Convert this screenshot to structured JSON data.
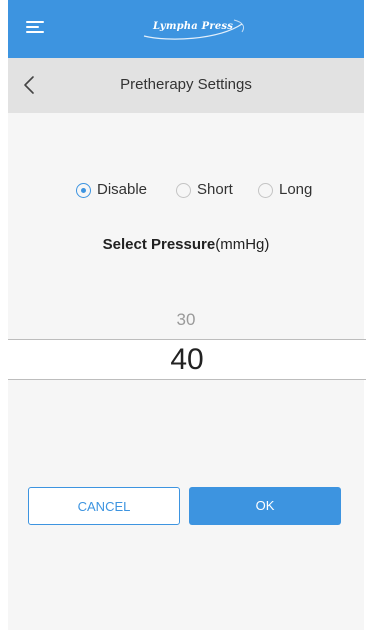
{
  "header": {
    "logo_text": "Lympha Press"
  },
  "subheader": {
    "title": "Pretherapy Settings"
  },
  "mode": {
    "options": [
      {
        "label": "Disable",
        "selected": true
      },
      {
        "label": "Short",
        "selected": false
      },
      {
        "label": "Long",
        "selected": false
      }
    ]
  },
  "pressure": {
    "label_bold": "Select Pressure",
    "label_unit": "(mmHg)",
    "previous_value": "30",
    "selected_value": "40"
  },
  "actions": {
    "cancel_label": "CANCEL",
    "ok_label": "OK"
  },
  "colors": {
    "accent": "#3d94e0",
    "header_bg": "#3d94e0",
    "subheader_bg": "#e2e2e2",
    "page_bg": "#f6f6f6"
  },
  "icons": {
    "menu": "menu-icon",
    "back": "back-arrow-icon"
  }
}
